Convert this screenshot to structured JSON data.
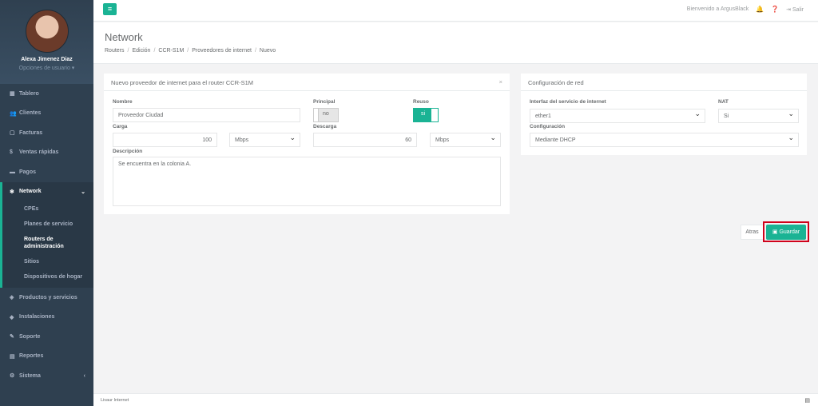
{
  "sidebar": {
    "user_name": "Alexa Jimenez Diaz",
    "user_options": "Opciones de usuario ▾",
    "items_top": [
      {
        "label": "Tablero",
        "icon": "dashboard-icon"
      },
      {
        "label": "Clientes",
        "icon": "users-icon"
      },
      {
        "label": "Facturas",
        "icon": "file-icon"
      },
      {
        "label": "Ventas rápidas",
        "icon": "dollar-icon"
      },
      {
        "label": "Pagos",
        "icon": "money-icon"
      }
    ],
    "active": {
      "label": "Network",
      "icon": "snowflake-icon"
    },
    "subitems": [
      "CPEs",
      "Planes de servicio",
      "Routers de administración",
      "Sitios",
      "Dispositivos de hogar"
    ],
    "items_bottom": [
      {
        "label": "Productos y servicios",
        "icon": "tag-icon"
      },
      {
        "label": "Instalaciones",
        "icon": "diamond-icon"
      },
      {
        "label": "Soporte",
        "icon": "wrench-icon"
      },
      {
        "label": "Reportes",
        "icon": "book-icon"
      },
      {
        "label": "Sistema",
        "icon": "cogs-icon"
      }
    ]
  },
  "topbar": {
    "welcome": "Bienvenido a ArgusBlack",
    "logout": "Salir"
  },
  "heading": {
    "title": "Network",
    "breadcrumb": [
      "Routers",
      "Edición",
      "CCR-S1M",
      "Proveedores de internet",
      "Nuevo"
    ]
  },
  "left_panel": {
    "title": "Nuevo proveedor de internet para el router CCR-S1M",
    "nombre_label": "Nombre",
    "nombre_value": "Proveedor Ciudad",
    "principal_label": "Principal",
    "principal_value": "no",
    "reuso_label": "Reuso",
    "reuso_value": "si",
    "carga_label": "Carga",
    "carga_value": "100",
    "carga_unit": "Mbps",
    "descarga_label": "Descarga",
    "descarga_value": "60",
    "descarga_unit": "Mbps",
    "descripcion_label": "Descripción",
    "descripcion_value": "Se encuentra en la colonia A."
  },
  "right_panel": {
    "title": "Configuración de red",
    "interfaz_label": "Interfaz del servicio de internet",
    "interfaz_value": "ether1",
    "nat_label": "NAT",
    "nat_value": "Si",
    "config_label": "Configuración",
    "config_value": "Mediante DHCP"
  },
  "actions": {
    "back": "Atras",
    "save": "Guardar"
  },
  "footer": {
    "text": "Livaur Internet"
  },
  "colors": {
    "accent": "#1ab394",
    "sidebar": "#2f4050",
    "highlight": "#d0021b"
  }
}
